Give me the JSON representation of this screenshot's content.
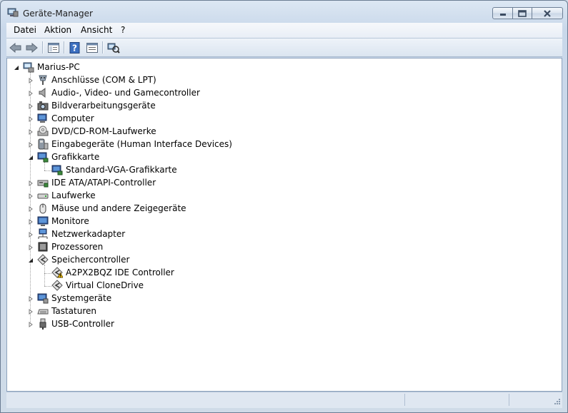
{
  "window": {
    "title": "Geräte-Manager"
  },
  "menu": {
    "items": [
      "Datei",
      "Aktion",
      "Ansicht",
      "?"
    ]
  },
  "toolbar": {
    "buttons": [
      "back-icon",
      "forward-icon",
      "console-tree-icon",
      "help-icon",
      "properties-icon",
      "scan-hardware-icon"
    ]
  },
  "tree": {
    "root": "Marius-PC",
    "items": [
      {
        "label": "Anschlüsse (COM & LPT)",
        "icon": "port-icon"
      },
      {
        "label": "Audio-, Video- und Gamecontroller",
        "icon": "speaker-icon"
      },
      {
        "label": "Bildverarbeitungsgeräte",
        "icon": "camera-icon"
      },
      {
        "label": "Computer",
        "icon": "computer-icon"
      },
      {
        "label": "DVD/CD-ROM-Laufwerke",
        "icon": "disc-drive-icon"
      },
      {
        "label": "Eingabegeräte (Human Interface Devices)",
        "icon": "hid-icon"
      },
      {
        "label": "Grafikkarte",
        "icon": "display-adapter-icon"
      },
      {
        "label": "Standard-VGA-Grafikkarte",
        "icon": "display-adapter-icon"
      },
      {
        "label": "IDE ATA/ATAPI-Controller",
        "icon": "ide-controller-icon"
      },
      {
        "label": "Laufwerke",
        "icon": "disk-drive-icon"
      },
      {
        "label": "Mäuse und andere Zeigegeräte",
        "icon": "mouse-icon"
      },
      {
        "label": "Monitore",
        "icon": "monitor-icon"
      },
      {
        "label": "Netzwerkadapter",
        "icon": "network-adapter-icon"
      },
      {
        "label": "Prozessoren",
        "icon": "processor-icon"
      },
      {
        "label": "Speichercontroller",
        "icon": "storage-controller-icon"
      },
      {
        "label": "A2PX2BQZ IDE Controller",
        "icon": "storage-warning-icon"
      },
      {
        "label": "Virtual CloneDrive",
        "icon": "storage-controller-icon"
      },
      {
        "label": "Systemgeräte",
        "icon": "system-device-icon"
      },
      {
        "label": "Tastaturen",
        "icon": "keyboard-icon"
      },
      {
        "label": "USB-Controller",
        "icon": "usb-icon"
      }
    ]
  },
  "colors": {
    "accent": "#1e64b4",
    "warning": "#f5c400"
  }
}
